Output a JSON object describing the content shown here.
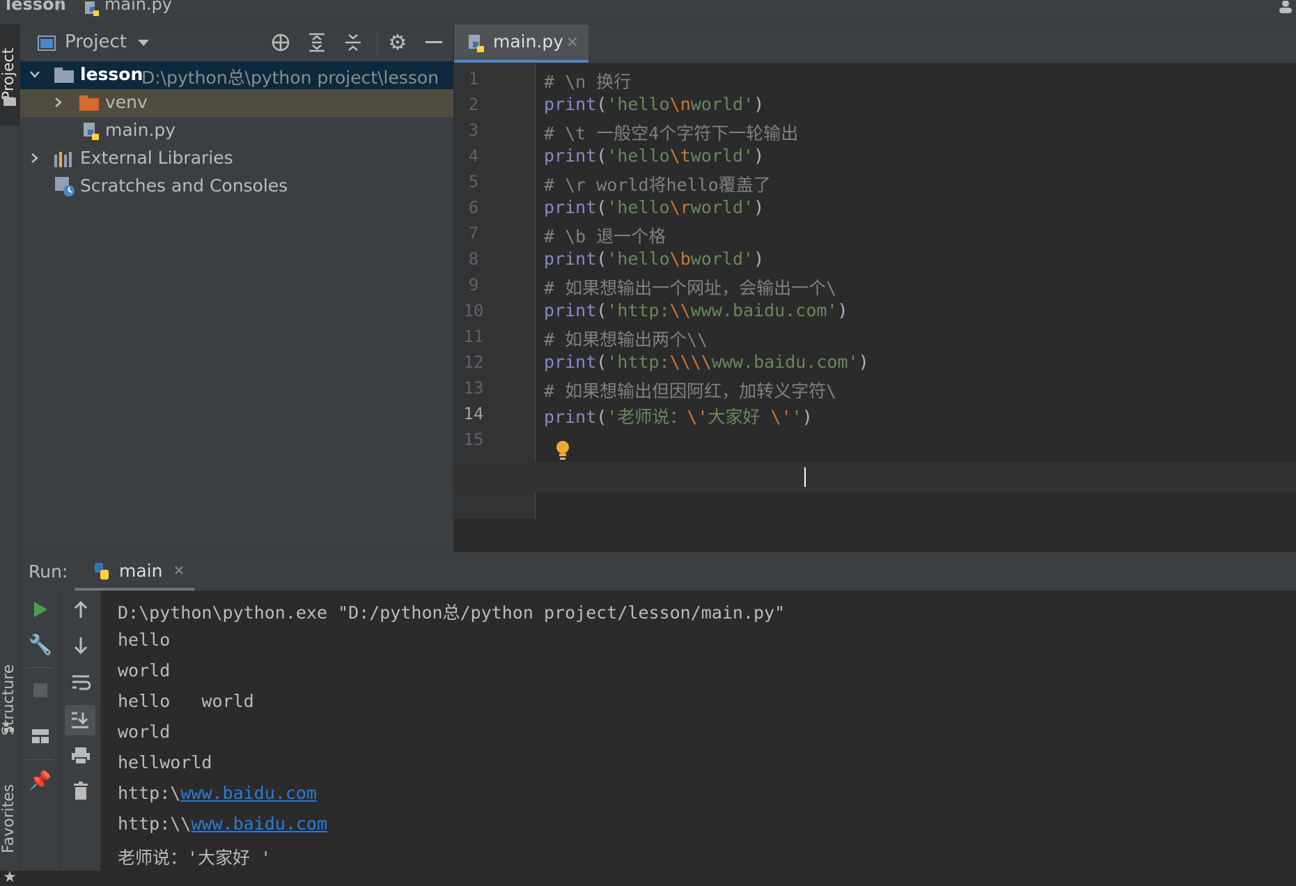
{
  "breadcrumb": {
    "project": "lesson",
    "file": "main.py"
  },
  "left_strip": {
    "project_label": "Project",
    "structure_label": "Structure",
    "favorites_label": "Favorites"
  },
  "project_panel": {
    "title": "Project",
    "tree": [
      {
        "name": "lesson",
        "path": "D:\\python总\\python project\\lesson",
        "expanded": true
      },
      {
        "name": "venv",
        "expanded": false
      },
      {
        "name": "main.py"
      },
      {
        "name": "External Libraries",
        "expanded": false
      },
      {
        "name": "Scratches and Consoles"
      }
    ]
  },
  "editor": {
    "tab_label": "main.py",
    "lines": [
      {
        "no": "1",
        "parts": [
          {
            "t": "# \\n 换行",
            "c": "cm"
          }
        ]
      },
      {
        "no": "2",
        "parts": [
          {
            "t": "print",
            "c": "kw"
          },
          {
            "t": "(",
            "c": "punc"
          },
          {
            "t": "'hello",
            "c": "str"
          },
          {
            "t": "\\n",
            "c": "esc"
          },
          {
            "t": "world'",
            "c": "str"
          },
          {
            "t": ")",
            "c": "punc"
          }
        ]
      },
      {
        "no": "3",
        "parts": [
          {
            "t": "# \\t 一般空4个字符下一轮输出",
            "c": "cm"
          }
        ]
      },
      {
        "no": "4",
        "parts": [
          {
            "t": "print",
            "c": "kw"
          },
          {
            "t": "(",
            "c": "punc"
          },
          {
            "t": "'hello",
            "c": "str"
          },
          {
            "t": "\\t",
            "c": "esc"
          },
          {
            "t": "world'",
            "c": "str"
          },
          {
            "t": ")",
            "c": "punc"
          }
        ]
      },
      {
        "no": "5",
        "parts": [
          {
            "t": "# \\r world将hello覆盖了",
            "c": "cm"
          }
        ]
      },
      {
        "no": "6",
        "parts": [
          {
            "t": "print",
            "c": "kw"
          },
          {
            "t": "(",
            "c": "punc"
          },
          {
            "t": "'hello",
            "c": "str"
          },
          {
            "t": "\\r",
            "c": "esc"
          },
          {
            "t": "world'",
            "c": "str"
          },
          {
            "t": ")",
            "c": "punc"
          }
        ]
      },
      {
        "no": "7",
        "parts": [
          {
            "t": "# \\b 退一个格",
            "c": "cm"
          }
        ]
      },
      {
        "no": "8",
        "parts": [
          {
            "t": "print",
            "c": "kw"
          },
          {
            "t": "(",
            "c": "punc"
          },
          {
            "t": "'hello",
            "c": "str"
          },
          {
            "t": "\\b",
            "c": "esc"
          },
          {
            "t": "world'",
            "c": "str"
          },
          {
            "t": ")",
            "c": "punc"
          }
        ]
      },
      {
        "no": "9",
        "parts": [
          {
            "t": "# 如果想输出一个网址，会输出一个\\",
            "c": "cm"
          }
        ]
      },
      {
        "no": "10",
        "parts": [
          {
            "t": "print",
            "c": "kw"
          },
          {
            "t": "(",
            "c": "punc"
          },
          {
            "t": "'http:",
            "c": "str"
          },
          {
            "t": "\\\\",
            "c": "esc"
          },
          {
            "t": "www.baidu.com'",
            "c": "str"
          },
          {
            "t": ")",
            "c": "punc"
          }
        ]
      },
      {
        "no": "11",
        "parts": [
          {
            "t": "# 如果想输出两个\\\\",
            "c": "cm"
          }
        ]
      },
      {
        "no": "12",
        "parts": [
          {
            "t": "print",
            "c": "kw"
          },
          {
            "t": "(",
            "c": "punc"
          },
          {
            "t": "'http:",
            "c": "str"
          },
          {
            "t": "\\\\\\\\",
            "c": "esc"
          },
          {
            "t": "www.baidu.com'",
            "c": "str"
          },
          {
            "t": ")",
            "c": "punc"
          }
        ]
      },
      {
        "no": "13",
        "parts": [
          {
            "t": "# 如果想输出但因阿红，加转义字符\\",
            "c": "cm"
          }
        ]
      },
      {
        "no": "14",
        "parts": [
          {
            "t": "print",
            "c": "kw"
          },
          {
            "t": "(",
            "c": "punc"
          },
          {
            "t": "'老师说：",
            "c": "str"
          },
          {
            "t": "\\'",
            "c": "esc"
          },
          {
            "t": "大家好 ",
            "c": "str"
          },
          {
            "t": "\\'",
            "c": "esc"
          },
          {
            "t": "'",
            "c": "str"
          },
          {
            "t": ")",
            "c": "punc"
          }
        ]
      },
      {
        "no": "15",
        "parts": []
      }
    ]
  },
  "run": {
    "label": "Run:",
    "tab": "main",
    "output": [
      {
        "t": "D:\\python\\python.exe \"D:/python总/python project/lesson/main.py\""
      },
      {
        "t": "hello"
      },
      {
        "t": "world"
      },
      {
        "t": "hello   world"
      },
      {
        "t": "world"
      },
      {
        "t": "hellworld"
      },
      {
        "t": "http:\\",
        "link": "www.baidu.com"
      },
      {
        "t": "http:\\\\",
        "link": "www.baidu.com"
      },
      {
        "t": "老师说：'大家好 '"
      }
    ]
  },
  "colors": {
    "accent": "#4a88c7",
    "bg": "#2b2b2b",
    "panel": "#3c3f41",
    "keyword": "#8888c6",
    "string": "#6a8759",
    "escape": "#cc7832",
    "comment": "#808080"
  }
}
